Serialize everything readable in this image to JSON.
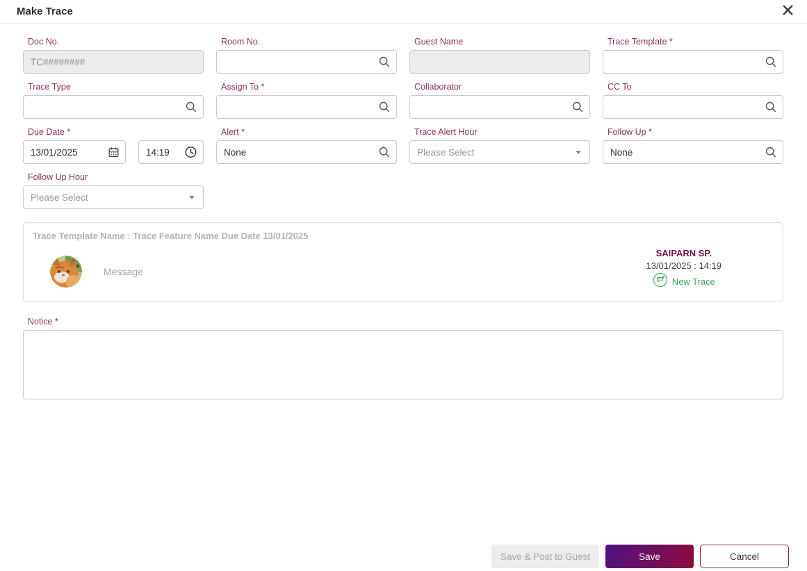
{
  "dialog": {
    "title": "Make Trace"
  },
  "fields": {
    "doc_no": {
      "label": "Doc No.",
      "value": "TC########"
    },
    "room_no": {
      "label": "Room No.",
      "value": ""
    },
    "guest_name": {
      "label": "Guest Name",
      "value": ""
    },
    "trace_template": {
      "label": "Trace Template *",
      "value": ""
    },
    "trace_type": {
      "label": "Trace Type",
      "value": ""
    },
    "assign_to": {
      "label": "Assign To *",
      "value": ""
    },
    "collaborator": {
      "label": "Collaborator",
      "value": ""
    },
    "cc_to": {
      "label": "CC To",
      "value": ""
    },
    "due_date": {
      "label": "Due Date *",
      "date_value": "13/01/2025",
      "time_value": "14:19"
    },
    "alert": {
      "label": "Alert *",
      "value": "None"
    },
    "trace_alert_hour": {
      "label": "Trace Alert Hour",
      "placeholder": "Please Select"
    },
    "follow_up": {
      "label": "Follow Up *",
      "value": "None"
    },
    "follow_up_hour": {
      "label": "Follow Up Hour",
      "placeholder": "Please Select"
    },
    "notice": {
      "label": "Notice *",
      "value": ""
    }
  },
  "preview": {
    "header": "Trace Template Name : Trace Feature Name Due Date 13/01/2025",
    "message_placeholder": "Message",
    "author": "SAIPARN SP.",
    "timestamp": "13/01/2025 : 14:19",
    "action_label": "New Trace"
  },
  "buttons": {
    "save_post": "Save & Post to Guest",
    "save": "Save",
    "cancel": "Cancel"
  },
  "colors": {
    "label": "#8e3160",
    "author": "#7a1446",
    "action_green": "#3fa45b",
    "save_gradient_start": "#4d1283",
    "save_gradient_end": "#8e0a3c",
    "cancel_border": "#7e2556"
  }
}
